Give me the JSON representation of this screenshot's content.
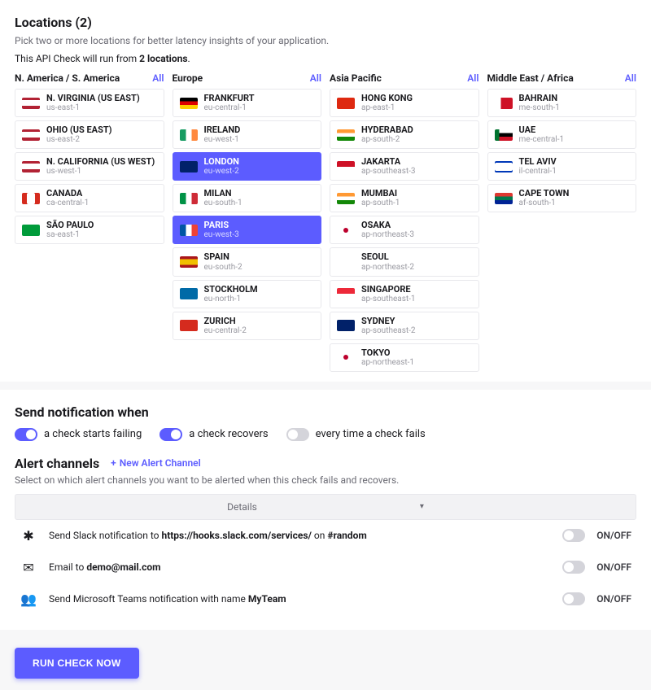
{
  "locations": {
    "title": "Locations (2)",
    "subtitle": "Pick two or more locations for better latency insights of your application.",
    "runline_prefix": "This API Check will run from ",
    "runline_bold": "2 locations",
    "runline_suffix": ".",
    "all_label": "All",
    "cols": [
      {
        "name": "N. America / S. America",
        "items": [
          {
            "city": "N. VIRGINIA (US EAST)",
            "region": "us-east-1",
            "flag": "f-us",
            "sel": false
          },
          {
            "city": "OHIO (US EAST)",
            "region": "us-east-2",
            "flag": "f-us",
            "sel": false
          },
          {
            "city": "N. CALIFORNIA (US WEST)",
            "region": "us-west-1",
            "flag": "f-us",
            "sel": false
          },
          {
            "city": "CANADA",
            "region": "ca-central-1",
            "flag": "f-ca",
            "sel": false
          },
          {
            "city": "SÃO PAULO",
            "region": "sa-east-1",
            "flag": "f-br",
            "sel": false
          }
        ]
      },
      {
        "name": "Europe",
        "items": [
          {
            "city": "FRANKFURT",
            "region": "eu-central-1",
            "flag": "f-de",
            "sel": false
          },
          {
            "city": "IRELAND",
            "region": "eu-west-1",
            "flag": "f-ie",
            "sel": false
          },
          {
            "city": "LONDON",
            "region": "eu-west-2",
            "flag": "f-gb",
            "sel": true
          },
          {
            "city": "MILAN",
            "region": "eu-south-1",
            "flag": "f-it",
            "sel": false
          },
          {
            "city": "PARIS",
            "region": "eu-west-3",
            "flag": "f-fr",
            "sel": true
          },
          {
            "city": "SPAIN",
            "region": "eu-south-2",
            "flag": "f-es",
            "sel": false
          },
          {
            "city": "STOCKHOLM",
            "region": "eu-north-1",
            "flag": "f-se",
            "sel": false
          },
          {
            "city": "ZURICH",
            "region": "eu-central-2",
            "flag": "f-ch",
            "sel": false
          }
        ]
      },
      {
        "name": "Asia Pacific",
        "items": [
          {
            "city": "HONG KONG",
            "region": "ap-east-1",
            "flag": "f-hk",
            "sel": false
          },
          {
            "city": "HYDERABAD",
            "region": "ap-south-2",
            "flag": "f-in",
            "sel": false
          },
          {
            "city": "JAKARTA",
            "region": "ap-southeast-3",
            "flag": "f-id",
            "sel": false
          },
          {
            "city": "MUMBAI",
            "region": "ap-south-1",
            "flag": "f-in",
            "sel": false
          },
          {
            "city": "OSAKA",
            "region": "ap-northeast-3",
            "flag": "f-jp",
            "sel": false
          },
          {
            "city": "SEOUL",
            "region": "ap-northeast-2",
            "flag": "f-kr",
            "sel": false
          },
          {
            "city": "SINGAPORE",
            "region": "ap-southeast-1",
            "flag": "f-sg",
            "sel": false
          },
          {
            "city": "SYDNEY",
            "region": "ap-southeast-2",
            "flag": "f-au",
            "sel": false
          },
          {
            "city": "TOKYO",
            "region": "ap-northeast-1",
            "flag": "f-jp",
            "sel": false
          }
        ]
      },
      {
        "name": "Middle East / Africa",
        "items": [
          {
            "city": "BAHRAIN",
            "region": "me-south-1",
            "flag": "f-bh",
            "sel": false
          },
          {
            "city": "UAE",
            "region": "me-central-1",
            "flag": "f-ae",
            "sel": false
          },
          {
            "city": "TEL AVIV",
            "region": "il-central-1",
            "flag": "f-il",
            "sel": false
          },
          {
            "city": "CAPE TOWN",
            "region": "af-south-1",
            "flag": "f-za",
            "sel": false
          }
        ]
      }
    ]
  },
  "notify": {
    "title": "Send notification when",
    "items": [
      {
        "label": "a check starts failing",
        "on": true
      },
      {
        "label": "a check recovers",
        "on": true
      },
      {
        "label": "every time a check fails",
        "on": false
      }
    ]
  },
  "channels": {
    "title": "Alert channels",
    "new_label": "New Alert Channel",
    "subtitle": "Select on which alert channels you want to be alerted when this check fails and recovers.",
    "details_label": "Details",
    "onoff": "ON/OFF",
    "items": [
      {
        "icon": "slack",
        "prefix": "Send Slack notification to ",
        "bold": "https://hooks.slack.com/services/",
        "mid": " on ",
        "bold2": "#random"
      },
      {
        "icon": "email",
        "prefix": "Email to ",
        "bold": "demo@mail.com",
        "mid": "",
        "bold2": ""
      },
      {
        "icon": "teams",
        "prefix": "Send Microsoft Teams notification with name ",
        "bold": "MyTeam",
        "mid": "",
        "bold2": ""
      }
    ]
  },
  "run_button": "RUN CHECK NOW"
}
